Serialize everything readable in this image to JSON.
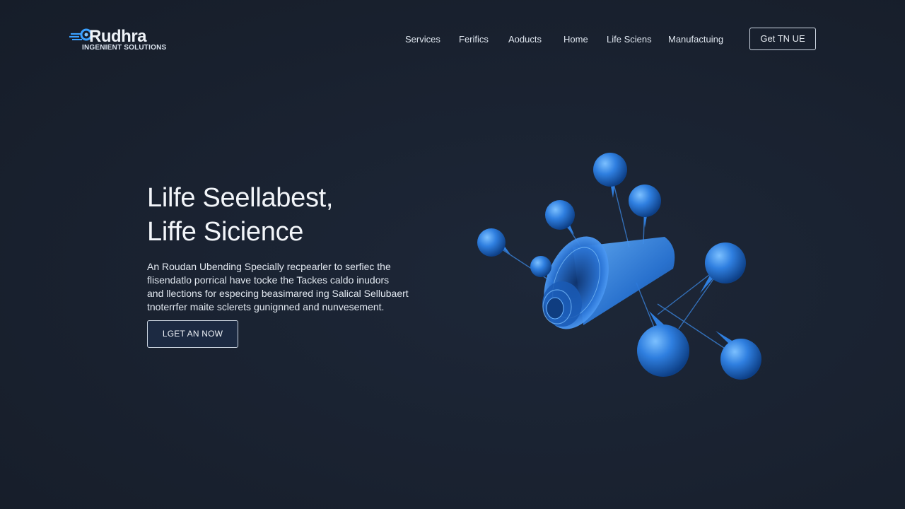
{
  "brand": {
    "name": "Rudhra",
    "tagline": "INGENIENT SOLUTIONS"
  },
  "nav": {
    "items": [
      {
        "label": "Services"
      },
      {
        "label": "Ferifics"
      },
      {
        "label": "Aoducts"
      },
      {
        "label": "Home"
      },
      {
        "label": "Life Sciens"
      },
      {
        "label": "Manufactuing"
      }
    ],
    "cta_label": "Get TN UE"
  },
  "hero": {
    "title_lines": [
      "Lilfe Seellabest,",
      "Liffe Sicience"
    ],
    "description_lines": [
      "An Roudan Ubending Specially recpearler to serfiec the",
      "flisendatlo porrical have tocke the Tackes caldo inudors",
      "and llections for especing beasimared ing Salical Sellubaert",
      "tnoterrfer maite sclerets gunignned and nunvesement."
    ],
    "button_label": "LGET AN NOW"
  },
  "colors": {
    "background": "#1a2333",
    "accent_blue": "#2f7fe0",
    "text": "#e8edf3"
  },
  "icons": {
    "logo": "rudhra-logo-swoosh-icon",
    "illustration": "molecule-funnel-illustration"
  }
}
